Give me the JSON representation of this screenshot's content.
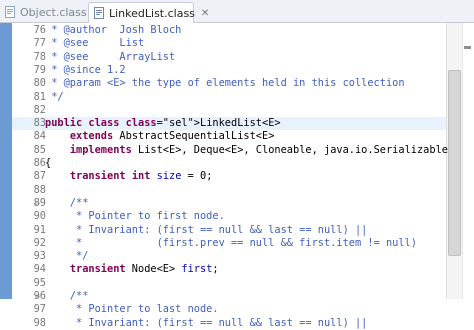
{
  "tabs": [
    {
      "label": "Object.class",
      "active": false
    },
    {
      "label": "LinkedList.class",
      "active": true,
      "close": "✕"
    }
  ],
  "lines": [
    {
      "n": "76",
      "code": " * @author  Josh Bloch"
    },
    {
      "n": "77",
      "code": " * @see     List"
    },
    {
      "n": "78",
      "code": " * @see     ArrayList"
    },
    {
      "n": "79",
      "code": " * @since 1.2"
    },
    {
      "n": "80",
      "code": " * @param <E> the type of elements held in this collection"
    },
    {
      "n": "81",
      "code": " */"
    },
    {
      "n": "82",
      "code": ""
    },
    {
      "n": "83",
      "code": "public class LinkedList<E>"
    },
    {
      "n": "84",
      "code": "    extends AbstractSequentialList<E>"
    },
    {
      "n": "85",
      "code": "    implements List<E>, Deque<E>, Cloneable, java.io.Serializable"
    },
    {
      "n": "86",
      "code": "{"
    },
    {
      "n": "87",
      "code": "    transient int size = 0;"
    },
    {
      "n": "88",
      "code": ""
    },
    {
      "n": "89",
      "code": "    /**"
    },
    {
      "n": "90",
      "code": "     * Pointer to first node."
    },
    {
      "n": "91",
      "code": "     * Invariant: (first == null && last == null) ||"
    },
    {
      "n": "92",
      "code": "     *            (first.prev == null && first.item != null)"
    },
    {
      "n": "93",
      "code": "     */"
    },
    {
      "n": "94",
      "code": "    transient Node<E> first;"
    },
    {
      "n": "95",
      "code": ""
    },
    {
      "n": "96",
      "code": "    /**"
    },
    {
      "n": "97",
      "code": "     * Pointer to last node."
    },
    {
      "n": "98",
      "code": "     * Invariant: (first == null && last == null) ||"
    }
  ],
  "colors": {
    "comment": "#3f5fbf",
    "keyword": "#7f0055",
    "field": "#0000c0",
    "selection": "#3399ff",
    "current_line": "#e8f2fe",
    "left_strip": "#6b9bd2"
  },
  "icons": {
    "object_tab_icon": "class-file-icon",
    "linkedlist_tab_icon": "class-file-icon"
  }
}
